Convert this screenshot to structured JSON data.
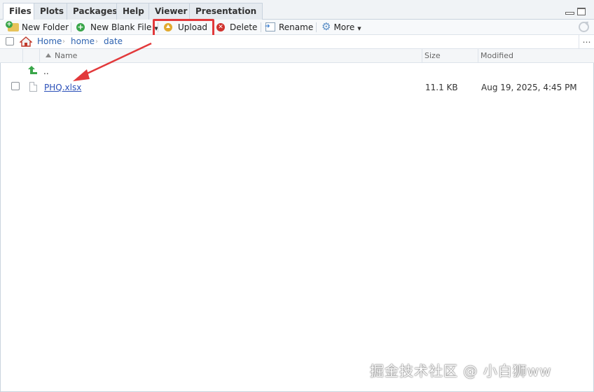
{
  "tabs": [
    {
      "label": "Files",
      "active": true
    },
    {
      "label": "Plots",
      "active": false
    },
    {
      "label": "Packages",
      "active": false
    },
    {
      "label": "Help",
      "active": false
    },
    {
      "label": "Viewer",
      "active": false
    },
    {
      "label": "Presentation",
      "active": false
    }
  ],
  "toolbar": {
    "new_folder": "New Folder",
    "new_blank_file": "New Blank File",
    "upload": "Upload",
    "delete": "Delete",
    "rename": "Rename",
    "more": "More"
  },
  "breadcrumb": [
    "Home",
    "home",
    "date"
  ],
  "columns": {
    "name": "Name",
    "size": "Size",
    "modified": "Modified"
  },
  "parent_dir": "..",
  "files": [
    {
      "name": "PHQ.xlsx",
      "size": "11.1 KB",
      "modified": "Aug 19, 2025, 4:45 PM"
    }
  ],
  "annotation": {
    "highlight_color": "#e2393b"
  },
  "watermark": "掘金技术社区 @ 小白狮ww"
}
